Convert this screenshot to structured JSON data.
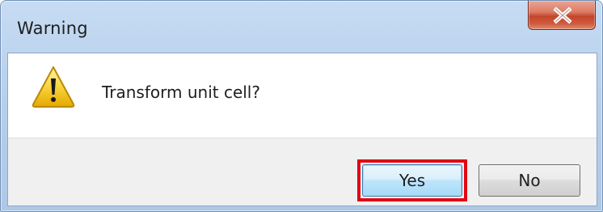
{
  "window": {
    "title": "Warning",
    "close_icon": "close-icon"
  },
  "dialog": {
    "icon": "warning-icon",
    "message": "Transform unit cell?"
  },
  "buttons": {
    "yes_label": "Yes",
    "no_label": "No",
    "highlighted": "Yes"
  },
  "colors": {
    "highlight": "#e30613",
    "close_button": "#c4452a",
    "titlebar": "#bcd3ee"
  }
}
